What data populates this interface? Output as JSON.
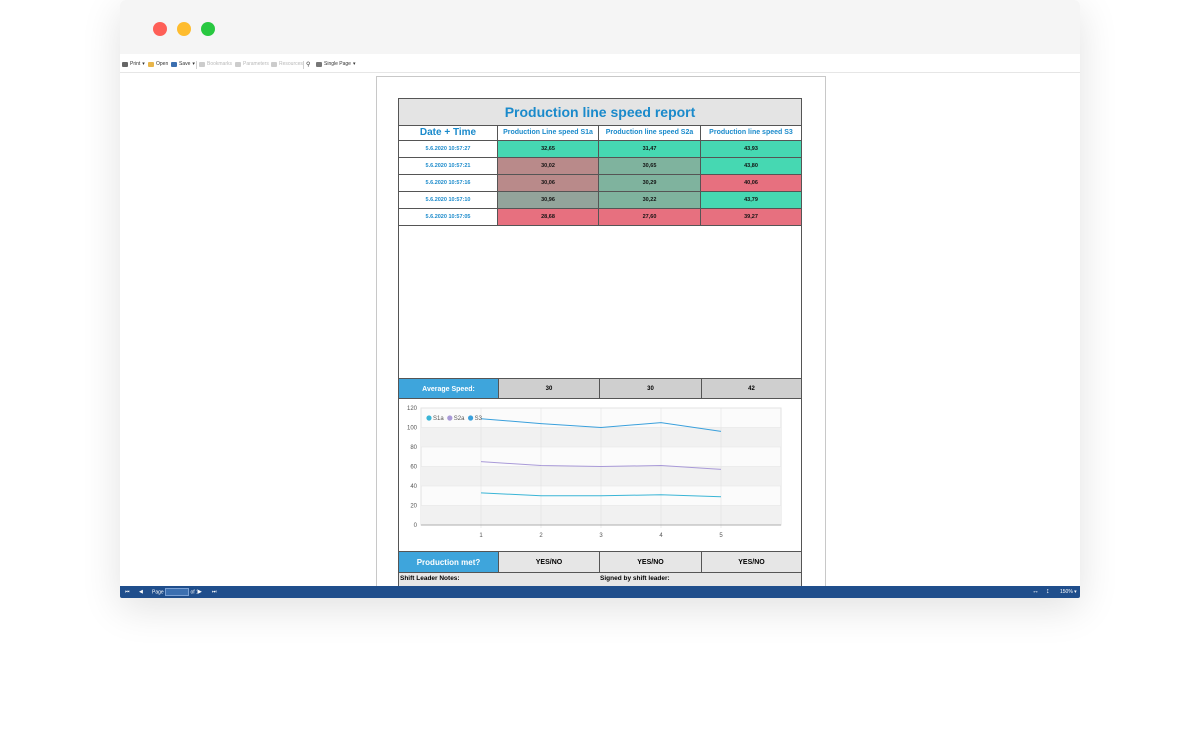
{
  "toolbar": {
    "print": "Print",
    "open": "Open",
    "save": "Save",
    "bookmarks": "Bookmarks",
    "parameters": "Parameters",
    "resources": "Resources",
    "view_mode": "Single Page"
  },
  "report": {
    "title": "Production line speed report",
    "headers": [
      "Date + Time",
      "Production Line speed S1a",
      "Production line speed S2a",
      "Production line speed S3"
    ],
    "rows": [
      {
        "date": "5.6.2020 10:57:27",
        "s1a": "32,65",
        "s2a": "31,47",
        "s3": "43,93"
      },
      {
        "date": "5.6.2020 10:57:21",
        "s1a": "30,02",
        "s2a": "30,65",
        "s3": "43,80"
      },
      {
        "date": "5.6.2020 10:57:16",
        "s1a": "30,06",
        "s2a": "30,29",
        "s3": "40,06"
      },
      {
        "date": "5.6.2020 10:57:10",
        "s1a": "30,96",
        "s2a": "30,22",
        "s3": "43,79"
      },
      {
        "date": "5.6.2020 10:57:05",
        "s1a": "28,68",
        "s2a": "27,60",
        "s3": "39,27"
      }
    ],
    "cell_colors": [
      [
        "#46d8b2",
        "#46d8b2",
        "#46d8b2"
      ],
      [
        "#b98a8a",
        "#7fb39e",
        "#46d8b2"
      ],
      [
        "#b98a8a",
        "#7fb39e",
        "#e7707f"
      ],
      [
        "#93a49b",
        "#7fb39e",
        "#46d8b2"
      ],
      [
        "#e7707f",
        "#e7707f",
        "#e7707f"
      ]
    ],
    "average_label": "Average Speed:",
    "averages": [
      "30",
      "30",
      "42"
    ],
    "production_met_label": "Production met?",
    "production_met": [
      "YES/NO",
      "YES/NO",
      "YES/NO"
    ],
    "notes_label": "Shift Leader Notes:",
    "signed_label": "Signed by shift leader:"
  },
  "chart_data": {
    "type": "line",
    "x": [
      1,
      2,
      3,
      4,
      5
    ],
    "ylim": [
      0,
      120
    ],
    "yticks": [
      0,
      20,
      40,
      60,
      80,
      100,
      120
    ],
    "grid": true,
    "legend": "top-left",
    "series": [
      {
        "name": "S1a",
        "color": "#3ab5d6",
        "values": [
          33,
          30,
          30,
          31,
          29
        ]
      },
      {
        "name": "S2a",
        "color": "#a99ad8",
        "values": [
          65,
          61,
          60,
          61,
          57
        ]
      },
      {
        "name": "S3",
        "color": "#3aa0dc",
        "values": [
          109,
          104,
          100,
          105,
          96
        ]
      }
    ]
  },
  "statusbar": {
    "page_label": "Page",
    "page_of": "of 1",
    "zoom": "150%"
  }
}
